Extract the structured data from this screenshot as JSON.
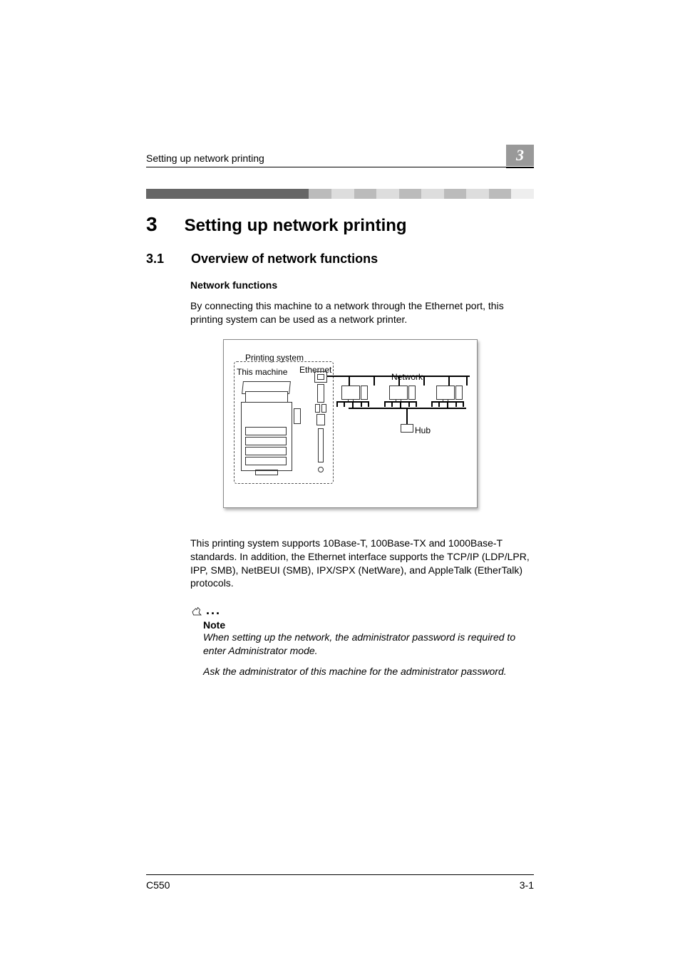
{
  "header": {
    "running_title": "Setting up network printing",
    "chapter_badge": "3"
  },
  "chapter": {
    "number": "3",
    "title": "Setting up network printing"
  },
  "section": {
    "number": "3.1",
    "title": "Overview of network functions"
  },
  "subsection": {
    "title": "Network functions"
  },
  "paragraph1": "By connecting this machine to a network through the Ethernet port, this printing system can be used as a network printer.",
  "diagram": {
    "labels": {
      "printing_system": "Printing system",
      "this_machine": "This machine",
      "ethernet": "Ethernet",
      "network": "Network",
      "hub": "Hub"
    }
  },
  "paragraph2": "This printing system supports 10Base-T, 100Base-TX and 1000Base-T standards. In addition, the Ethernet interface supports the TCP/IP (LDP/LPR, IPP, SMB), NetBEUI (SMB), IPX/SPX (NetWare), and AppleTalk (EtherTalk) protocols.",
  "note": {
    "label": "Note",
    "line1": "When setting up the network, the administrator password is required to enter Administrator mode.",
    "line2": "Ask the administrator of this machine for the administrator password."
  },
  "footer": {
    "model": "C550",
    "page": "3-1"
  }
}
